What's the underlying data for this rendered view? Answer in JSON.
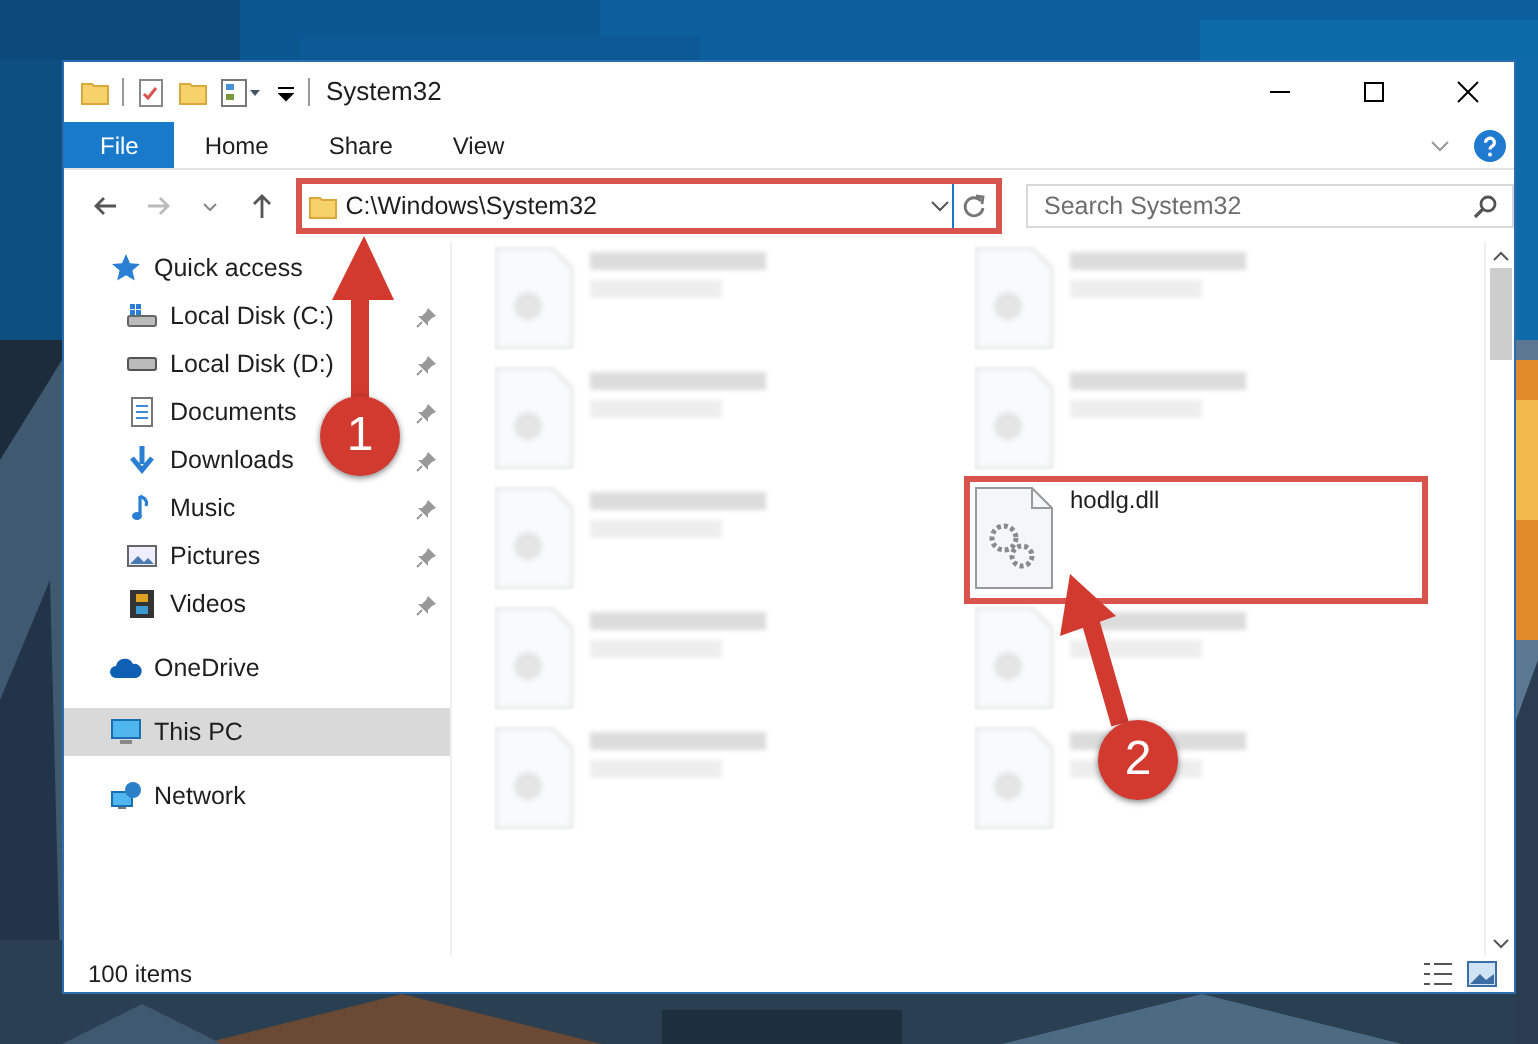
{
  "window": {
    "title": "System32"
  },
  "ribbon_tabs": [
    {
      "label": "File",
      "selected": true
    },
    {
      "label": "Home",
      "selected": false
    },
    {
      "label": "Share",
      "selected": false
    },
    {
      "label": "View",
      "selected": false
    }
  ],
  "address_bar": {
    "value": "C:\\Windows\\System32",
    "highlighted": true
  },
  "search": {
    "placeholder": "Search System32"
  },
  "navigation": [
    {
      "label": "Quick access",
      "selected": false,
      "children": [
        {
          "label": "Local Disk (C:)",
          "pinned": true
        },
        {
          "label": "Local Disk (D:)",
          "pinned": true
        },
        {
          "label": "Documents",
          "pinned": true
        },
        {
          "label": "Downloads",
          "pinned": true
        },
        {
          "label": "Music",
          "pinned": true
        },
        {
          "label": "Pictures",
          "pinned": true
        },
        {
          "label": "Videos",
          "pinned": true
        }
      ]
    },
    {
      "label": "OneDrive",
      "selected": false
    },
    {
      "label": "This PC",
      "selected": true
    },
    {
      "label": "Network",
      "selected": false
    }
  ],
  "files": [
    {
      "blurred": true,
      "highlighted": false
    },
    {
      "blurred": true,
      "highlighted": false
    },
    {
      "blurred": true,
      "highlighted": false
    },
    {
      "blurred": true,
      "highlighted": false
    },
    {
      "blurred": true,
      "highlighted": false
    },
    {
      "name": "hodlg.dll",
      "blurred": false,
      "highlighted": true
    },
    {
      "blurred": true,
      "highlighted": false
    },
    {
      "blurred": true,
      "highlighted": false
    },
    {
      "blurred": true,
      "highlighted": false
    },
    {
      "blurred": true,
      "highlighted": false
    }
  ],
  "annotations": [
    {
      "number": "1"
    },
    {
      "number": "2"
    }
  ],
  "status_bar": {
    "item_count": "100 items"
  }
}
